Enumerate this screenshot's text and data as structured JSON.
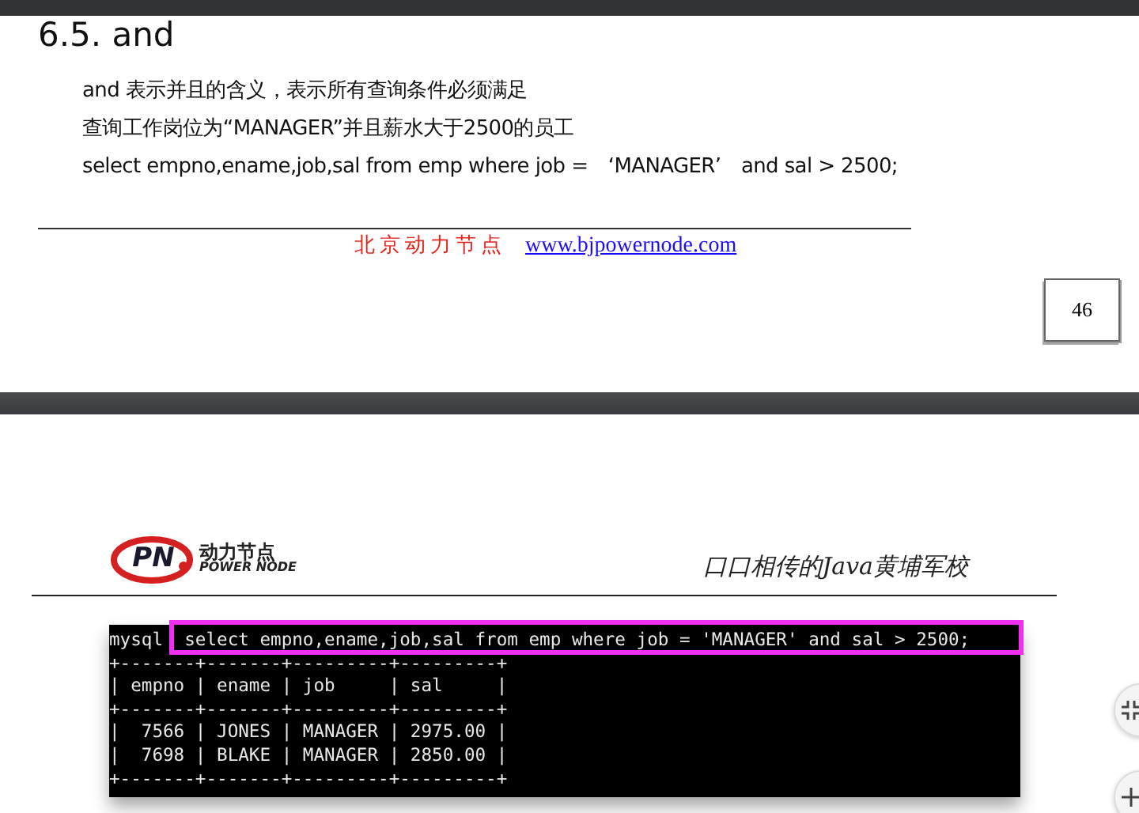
{
  "page_1": {
    "heading": "6.5. and",
    "paragraphs": [
      "and 表示并且的含义，表示所有查询条件必须满足",
      "查询工作岗位为“MANAGER”并且薪水大于2500的员工",
      "select empno,ename,job,sal from emp where job =　‘MANAGER’　and sal > 2500;"
    ],
    "footer": {
      "company": "北京动力节点",
      "link": "www.bjpowernode.com"
    },
    "page_number": "46"
  },
  "page_2": {
    "logo": {
      "mark": "PN",
      "name": "动力节点",
      "subtitle": "POWER NODE"
    },
    "slogan": "口口相传的Java黄埔军校",
    "terminal": {
      "prompt": "mysql",
      "command": "select empno,ename,job,sal from emp where job = 'MANAGER' and sal > 2500;",
      "lines": [
        "+-------+-------+---------+---------+",
        "| empno | ename | job     | sal     |",
        "+-------+-------+---------+---------+",
        "|  7566 | JONES | MANAGER | 2975.00 |",
        "|  7698 | BLAKE | MANAGER | 2850.00 |",
        "+-------+-------+---------+---------+"
      ],
      "highlighted": true
    }
  }
}
